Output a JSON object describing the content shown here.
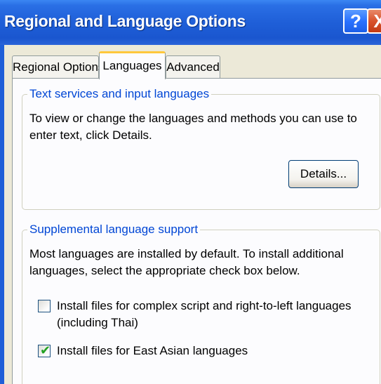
{
  "window": {
    "title": "Regional and Language Options",
    "help_label": "?",
    "close_label": "X"
  },
  "tabs": [
    {
      "label": "Regional Options",
      "selected": false
    },
    {
      "label": "Languages",
      "selected": true
    },
    {
      "label": "Advanced",
      "selected": false
    }
  ],
  "text_services": {
    "legend": "Text services and input languages",
    "description": "To view or change the languages and methods you can use to enter text, click Details.",
    "details_button": "Details..."
  },
  "supplemental": {
    "legend": "Supplemental language support",
    "description": "Most languages are installed by default. To install additional languages, select the appropriate check box below.",
    "options": [
      {
        "label": "Install files for complex script and right-to-left languages (including Thai)",
        "checked": false
      },
      {
        "label": "Install files for East Asian languages",
        "checked": true
      }
    ]
  },
  "colors": {
    "titlebar": "#1f5fd8",
    "legend_text": "#0046d5",
    "tab_highlight": "#ffc83c",
    "checkmark": "#21a121"
  }
}
